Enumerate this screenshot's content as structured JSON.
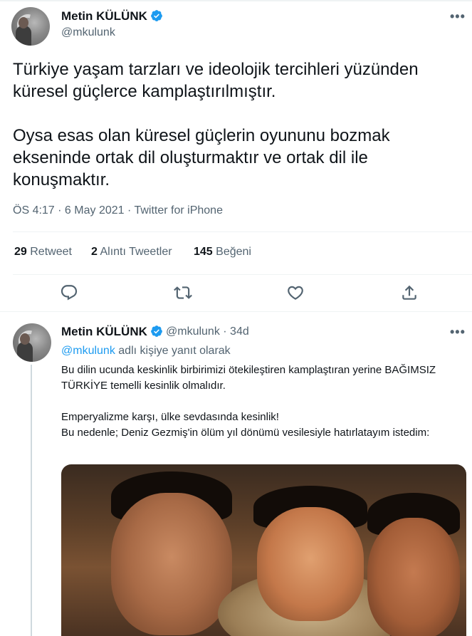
{
  "main_tweet": {
    "display_name": "Metin KÜLÜNK",
    "handle": "@mkulunk",
    "paragraphs": [
      "Türkiye yaşam tarzları ve ideolojik tercihleri yüzünden küresel güçlerce kamplaştırılmıştır.",
      "Oysa esas olan küresel güçlerin oyununu bozmak ekseninde ortak dil oluşturmaktır ve ortak dil ile konuşmaktır."
    ],
    "meta": "ÖS 4:17 · 6 May 2021 · Twitter for iPhone",
    "stats": {
      "retweets": "29",
      "retweets_label": "Retweet",
      "quotes": "2",
      "quotes_label": "Alıntı Tweetler",
      "likes": "145",
      "likes_label": "Beğeni"
    },
    "more": "•••"
  },
  "reply_tweet": {
    "display_name": "Metin KÜLÜNK",
    "handle_time": "@mkulunk · 34d",
    "reply_to_handle": "@mkulunk",
    "reply_to_suffix": " adlı kişiye yanıt olarak",
    "paragraphs": [
      "Bu dilin ucunda keskinlik birbirimizi ötekileştiren kamplaştıran yerine BAĞIMSIZ TÜRKİYE temelli kesinlik olmalıdır.",
      "Emperyalizme karşı, ülke sevdasında kesinlik!\nBu nedenle; Deniz Gezmiş'in ölüm yıl dönümü vesilesiyle hatırlatayım istedim:"
    ],
    "more": "•••"
  },
  "icons": {
    "reply": "reply-icon",
    "retweet": "retweet-icon",
    "like": "heart-icon",
    "share": "share-icon",
    "verified": "verified-badge-icon"
  },
  "colors": {
    "text": "#0f1419",
    "secondary": "#536471",
    "link": "#1d9bf0",
    "verified": "#1d9bf0"
  }
}
